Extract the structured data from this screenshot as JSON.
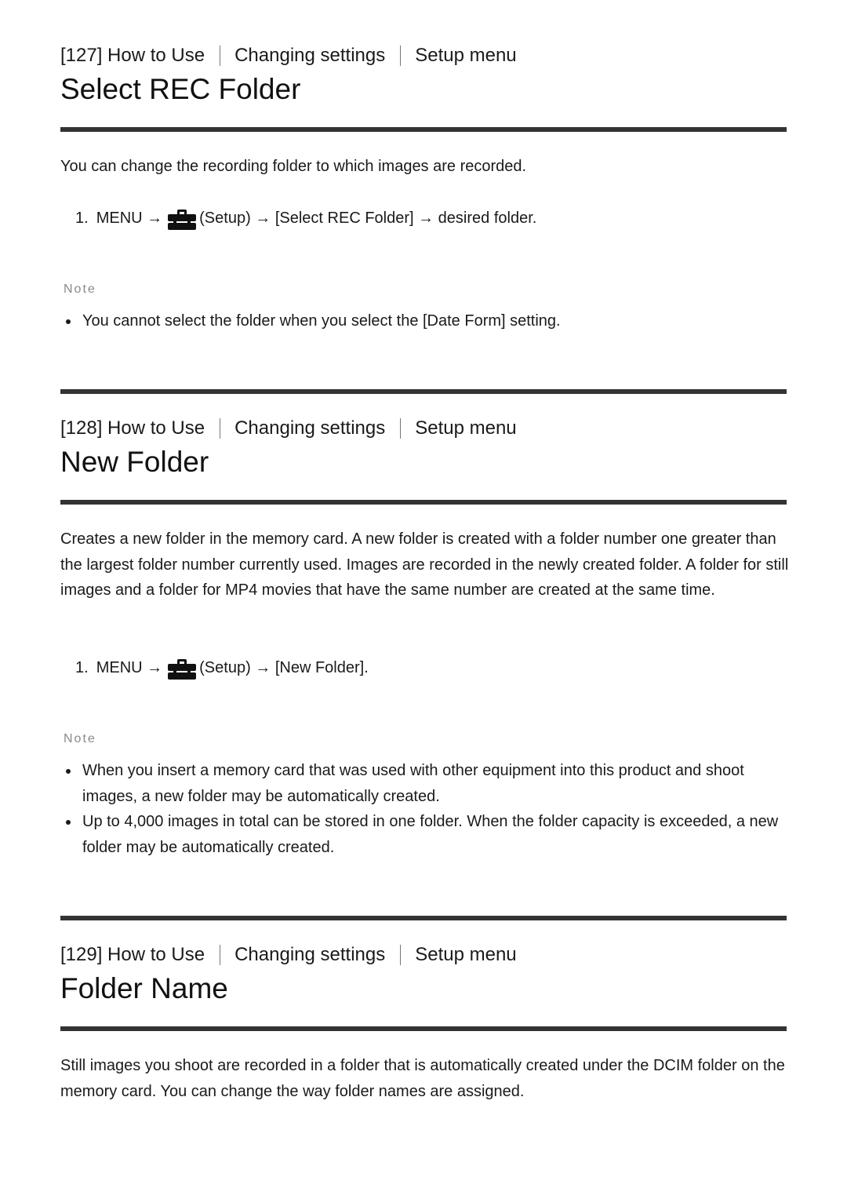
{
  "sections": [
    {
      "breadcrumb": [
        "[127] How to Use",
        "Changing settings",
        "Setup menu"
      ],
      "title": "Select REC Folder",
      "intro": "You can change the recording folder to which images are recorded.",
      "step": {
        "number": "1.",
        "prefix": "MENU →",
        "icon": "toolbox-icon",
        "suffix": "(Setup) → [Select REC Folder] → desired folder."
      },
      "note_label": "Note",
      "notes": [
        "You cannot select the folder when you select the [Date Form] setting."
      ]
    },
    {
      "breadcrumb": [
        "[128] How to Use",
        "Changing settings",
        "Setup menu"
      ],
      "title": "New Folder",
      "intro": "Creates a new folder in the memory card. A new folder is created with a folder number one greater than the largest folder number currently used. Images are recorded in the newly created folder. A folder for still images and a folder for MP4 movies that have the same number are created at the same time.",
      "step": {
        "number": "1.",
        "prefix": "MENU →",
        "icon": "toolbox-icon",
        "suffix": "(Setup) → [New Folder]."
      },
      "note_label": "Note",
      "notes": [
        "When you insert a memory card that was used with other equipment into this product and shoot images, a new folder may be automatically created.",
        "Up to 4,000 images in total can be stored in one folder. When the folder capacity is exceeded, a new folder may be automatically created."
      ]
    },
    {
      "breadcrumb": [
        "[129] How to Use",
        "Changing settings",
        "Setup menu"
      ],
      "title": "Folder Name",
      "intro": "Still images you shoot are recorded in a folder that is automatically created under the DCIM folder on the memory card. You can change the way folder names are assigned."
    }
  ],
  "colors": {
    "text": "#1a1a1a",
    "rule": "#333333",
    "note_label": "#8a8a8a"
  }
}
